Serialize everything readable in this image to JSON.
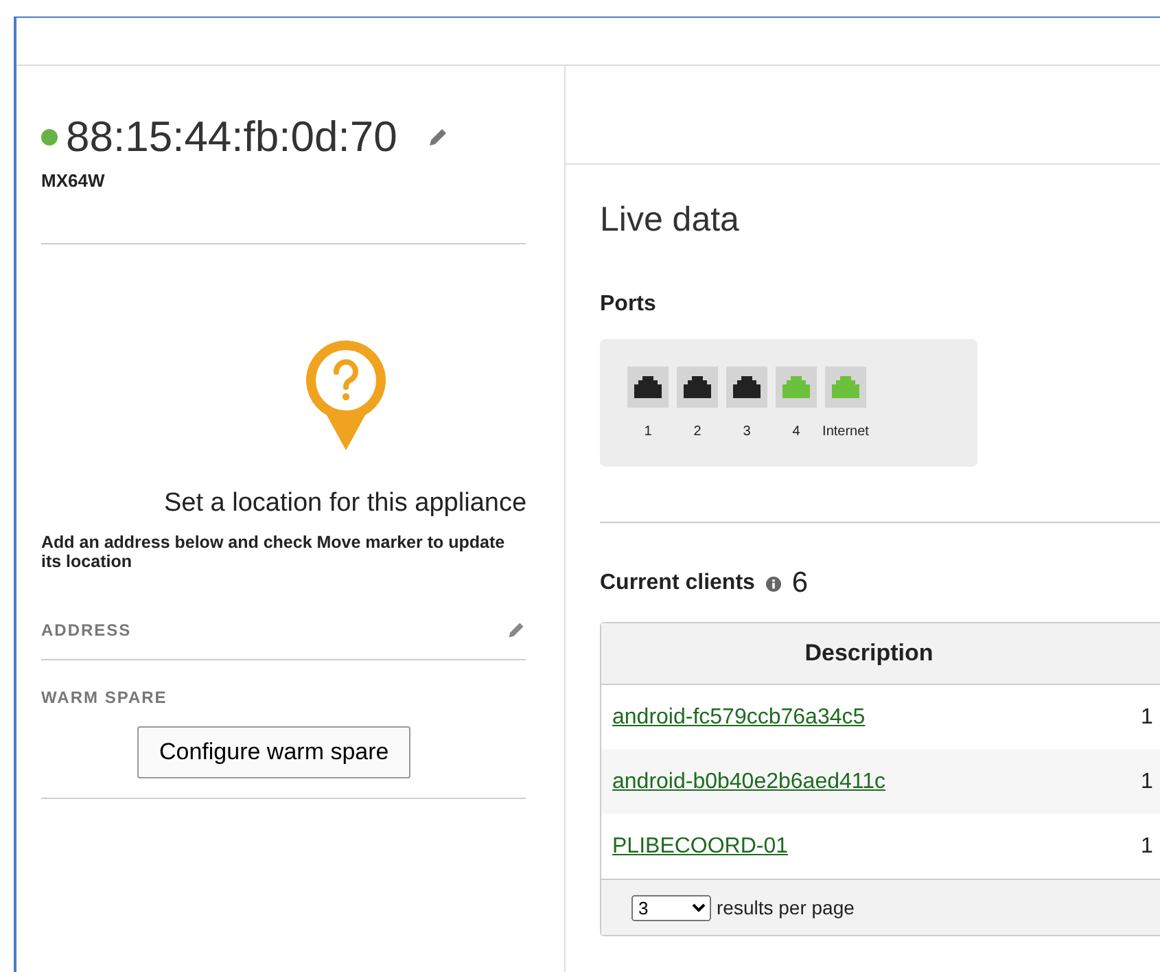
{
  "device": {
    "online": true,
    "mac": "88:15:44:fb:0d:70",
    "model": "MX64W"
  },
  "location": {
    "title": "Set a location for this appliance",
    "hint": "Add an address below and check Move marker to update its location"
  },
  "fields": [
    {
      "label": "ADDRESS",
      "editable": true
    },
    {
      "label": "WARM SPARE",
      "editable": false,
      "button": "Configure warm spare"
    }
  ],
  "live_data": {
    "title": "Live data",
    "ports_label": "Ports",
    "ports": [
      {
        "label": "1",
        "connected": false
      },
      {
        "label": "2",
        "connected": false
      },
      {
        "label": "3",
        "connected": false
      },
      {
        "label": "4",
        "connected": true
      },
      {
        "label": "Internet",
        "connected": true
      }
    ]
  },
  "clients": {
    "title": "Current clients",
    "count": "6",
    "columns": [
      "Description"
    ],
    "rows": [
      {
        "description": "android-fc579ccb76a34c5",
        "column_2": "1"
      },
      {
        "description": "android-b0b40e2b6aed411c",
        "column_2": "1"
      },
      {
        "description": "PLIBECOORD-01",
        "column_2": "1"
      }
    ],
    "per_page": "3",
    "per_page_label": "results per page"
  }
}
